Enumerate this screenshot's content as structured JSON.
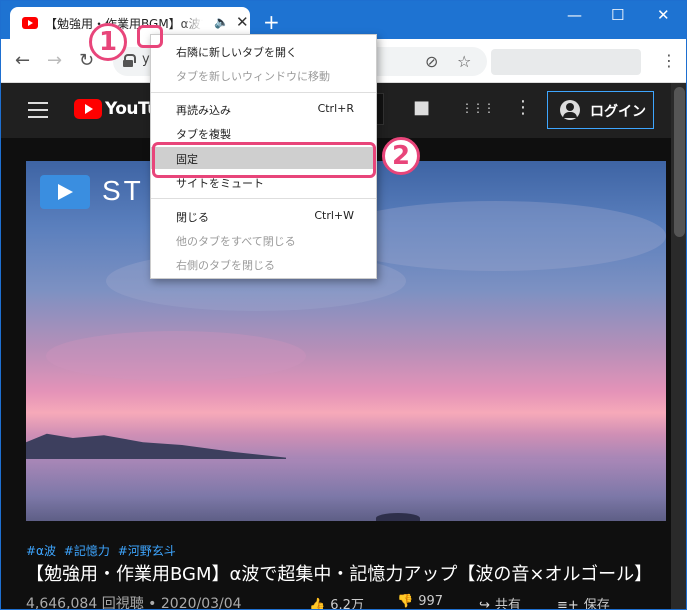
{
  "browser": {
    "tab_title": "【勉強用・作業用BGM】α波で超集中・記憶力アップ【波の音×オルゴール】",
    "url_partial": "y",
    "new_tab_symbol": "+",
    "window_controls": {
      "minimize": "—",
      "maximize": "☐",
      "close": "✕"
    }
  },
  "context_menu": {
    "items": [
      {
        "label": "右隣に新しいタブを開く",
        "shortcut": "",
        "enabled": true
      },
      {
        "label": "タブを新しいウィンドウに移動",
        "shortcut": "",
        "enabled": false
      },
      {
        "label": "再読み込み",
        "shortcut": "Ctrl+R",
        "enabled": true
      },
      {
        "label": "タブを複製",
        "shortcut": "",
        "enabled": true
      },
      {
        "label": "固定",
        "shortcut": "",
        "enabled": true,
        "highlighted": true
      },
      {
        "label": "サイトをミュート",
        "shortcut": "",
        "enabled": true
      },
      {
        "label": "閉じる",
        "shortcut": "Ctrl+W",
        "enabled": true
      },
      {
        "label": "他のタブをすべて閉じる",
        "shortcut": "",
        "enabled": false
      },
      {
        "label": "右側のタブを閉じる",
        "shortcut": "",
        "enabled": false
      }
    ]
  },
  "youtube": {
    "logo_text": "YouTube",
    "login_label": "ログイン",
    "thumbnail_brand": "ST",
    "hashtags": [
      "#α波",
      "#記憶力",
      "#河野玄斗"
    ],
    "title": "【勉強用・作業用BGM】α波で超集中・記憶力アップ【波の音×オルゴール】",
    "views": "4,646,084 回視聴",
    "separator": "•",
    "date": "2020/03/04",
    "likes": "6.2万",
    "dislikes": "997",
    "share_label": "共有",
    "save_label": "保存"
  },
  "annotations": {
    "step1": "1",
    "step2": "2",
    "color": "#e8457a"
  },
  "icons": {
    "back": "←",
    "forward": "→",
    "reload": "↻",
    "eye_off": "⊘",
    "star": "☆",
    "more": "⋮",
    "audio": "🔈",
    "tab_close": "✕",
    "video_camera": "■",
    "apps": "⋮⋮⋮",
    "yt_more": "⋮",
    "like": "👍",
    "dislike": "👎",
    "share": "↪",
    "save_playlist": "≡+"
  }
}
